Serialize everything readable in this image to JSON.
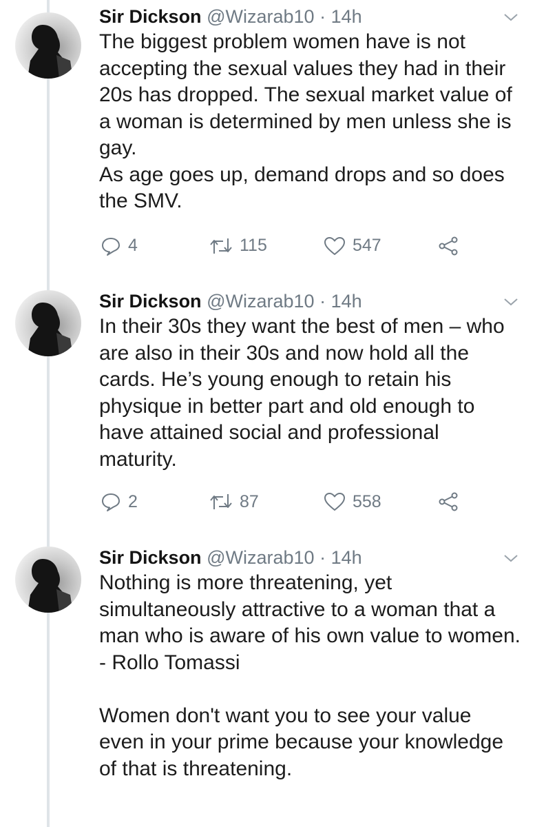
{
  "tweets": [
    {
      "name": "Sir Dickson",
      "handle": "@Wizarab10",
      "separator": "·",
      "time": "14h",
      "lines": [
        "The biggest problem women have is not accepting the sexual values they had in their 20s has dropped. The sexual market value of a woman is determined by men unless she is gay.",
        "As age goes up, demand drops and so does the SMV."
      ],
      "replies": "4",
      "retweets": "115",
      "likes": "547"
    },
    {
      "name": "Sir Dickson",
      "handle": "@Wizarab10",
      "separator": "·",
      "time": "14h",
      "lines": [
        "In their 30s they want the best of men – who are also in their 30s and now hold all the cards. He’s young enough to retain his physique in better part and old enough to have attained social and professional maturity."
      ],
      "replies": "2",
      "retweets": "87",
      "likes": "558"
    },
    {
      "name": "Sir Dickson",
      "handle": "@Wizarab10",
      "separator": "·",
      "time": "14h",
      "lines": [
        "Nothing is more threatening, yet simultaneously attractive to a woman that a man who is aware of his own value to women.",
        "- Rollo Tomassi",
        "",
        "Women don't want you to see your value even in your prime because your knowledge of that is threatening."
      ]
    }
  ],
  "colors": {
    "text": "#1c1c1c",
    "muted": "#6f7a84",
    "thread_line": "#dfe4e8"
  },
  "icons": [
    "reply-icon",
    "retweet-icon",
    "like-icon",
    "share-icon",
    "chevron-down-icon"
  ]
}
